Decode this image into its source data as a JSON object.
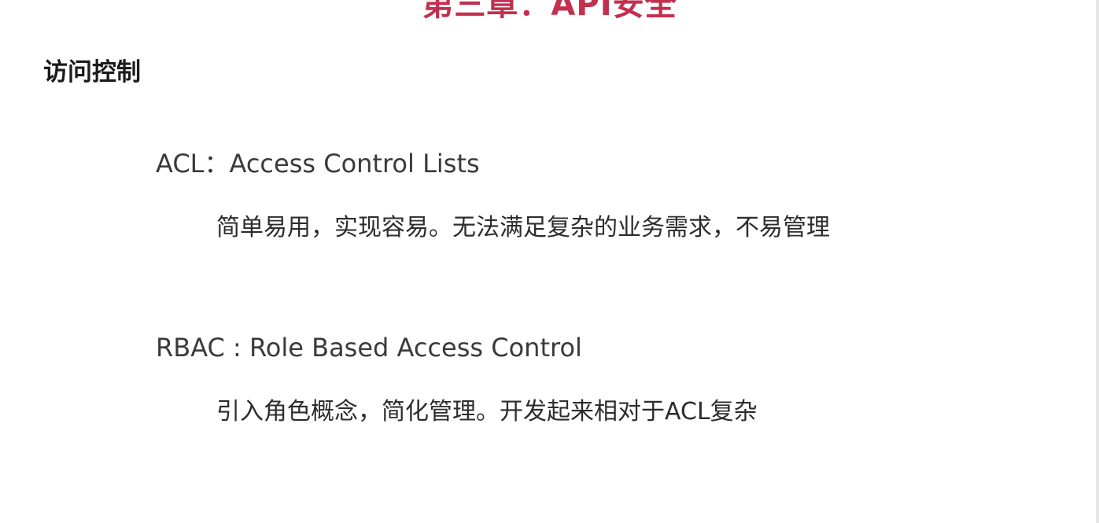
{
  "slide": {
    "chapter_title": "第三章：API安全",
    "section_heading": "访问控制",
    "items": [
      {
        "title": "ACL：Access Control Lists",
        "description": "简单易用，实现容易。无法满足复杂的业务需求，不易管理"
      },
      {
        "title": "RBAC : Role Based Access Control",
        "description": "引入角色概念，简化管理。开发起来相对于ACL复杂"
      }
    ]
  },
  "colors": {
    "title_accent": "#c2304e",
    "heading_text": "#1c1c1c",
    "body_text": "#3a3a3a"
  }
}
